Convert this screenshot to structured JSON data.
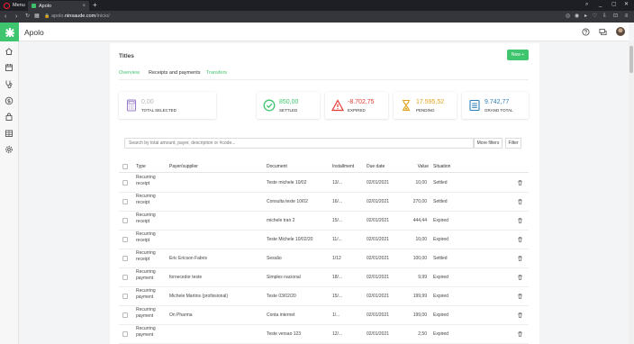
{
  "browser": {
    "menu_label": "Menu",
    "tab_title": "Apolo",
    "url_prefix": "apolo.",
    "url_host": "ninsaude.com",
    "url_path": "/inicio/"
  },
  "app": {
    "title": "Apolo"
  },
  "page": {
    "title": "Titles",
    "new_button": "New +",
    "tabs": [
      "Overview",
      "Receipts and payments",
      "Transfers"
    ],
    "active_tab": "Receipts and payments"
  },
  "cards": [
    {
      "value": "0,00",
      "label": "TOTAL SELECTED",
      "color": "#b5b5b5",
      "icon": "calculator-icon"
    },
    {
      "value": "850,00",
      "label": "SETTLED",
      "color": "#3fc56d",
      "icon": "check-circle-icon"
    },
    {
      "value": "-8.702,75",
      "label": "EXPIRED",
      "color": "#e53935",
      "icon": "warning-icon"
    },
    {
      "value": "17.595,52",
      "label": "PENDING",
      "color": "#e0a21b",
      "icon": "hourglass-icon"
    },
    {
      "value": "9.742,77",
      "label": "GRAND TOTAL",
      "color": "#2e7fb8",
      "icon": "document-icon"
    }
  ],
  "search": {
    "placeholder": "Search by total amount, payer, description or #code...",
    "more_filters": "More filters",
    "filter": "Filter"
  },
  "table": {
    "columns": [
      "Type",
      "Payer/supplier",
      "Document",
      "Installment",
      "Due date",
      "Value",
      "Situation"
    ],
    "rows": [
      {
        "type": "Recurring receipt",
        "payer": "",
        "document": "Teste michele 10/02",
        "installment": "13/...",
        "due": "02/01/2021",
        "value": "10,00",
        "situation": "Settled"
      },
      {
        "type": "Recurring receipt",
        "payer": "",
        "document": "Consulta teste 10/02",
        "installment": "16/...",
        "due": "02/01/2021",
        "value": "270,00",
        "situation": "Settled"
      },
      {
        "type": "Recurring receipt",
        "payer": "",
        "document": "michele tran 2",
        "installment": "15/...",
        "due": "02/01/2021",
        "value": "444,44",
        "situation": "Expired"
      },
      {
        "type": "Recurring receipt",
        "payer": "",
        "document": "Teste Michele 10/02/20",
        "installment": "11/...",
        "due": "02/01/2021",
        "value": "10,00",
        "situation": "Expired"
      },
      {
        "type": "Recurring receipt",
        "payer": "Eric Ericson Fabris",
        "document": "Sessão",
        "installment": "1/12",
        "due": "02/01/2021",
        "value": "100,00",
        "situation": "Settled"
      },
      {
        "type": "Recurring payment",
        "payer": "fornecedor teste",
        "document": "Simples nacional",
        "installment": "18/...",
        "due": "02/01/2021",
        "value": "9,99",
        "situation": "Expired"
      },
      {
        "type": "Recurring payment",
        "payer": "Michele Martins (profissional)",
        "document": "Teste 03/02/20",
        "installment": "15/...",
        "due": "02/01/2021",
        "value": "199,99",
        "situation": "Expired"
      },
      {
        "type": "Recurring payment",
        "payer": "On Pharma",
        "document": "Conta internet",
        "installment": "1/...",
        "due": "02/01/2021",
        "value": "199,00",
        "situation": "Expired"
      },
      {
        "type": "Recurring payment",
        "payer": "",
        "document": "Teste versao 123",
        "installment": "12/...",
        "due": "02/01/2021",
        "value": "2,50",
        "situation": "Expired"
      }
    ]
  }
}
